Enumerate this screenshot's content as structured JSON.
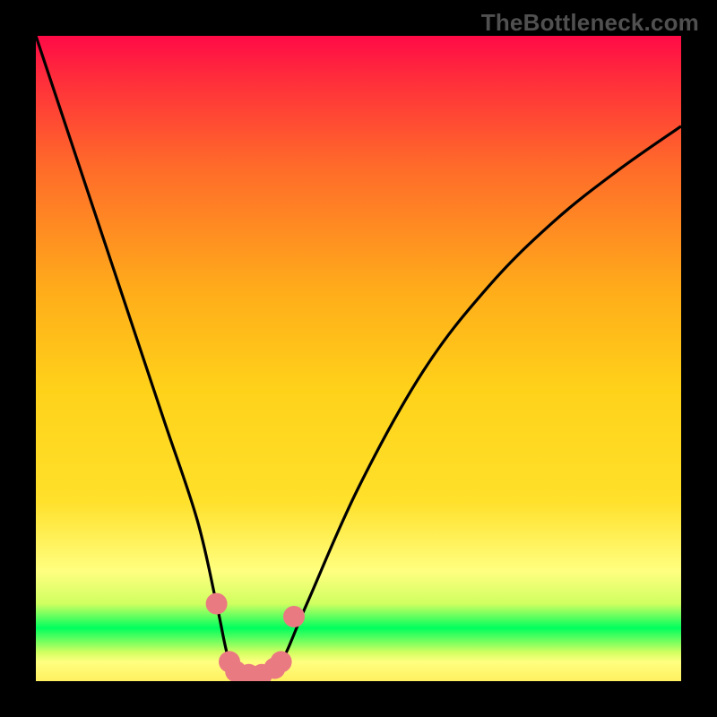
{
  "watermark": {
    "text": "TheBottleneck.com"
  },
  "chart_data": {
    "type": "line",
    "title": "",
    "xlabel": "",
    "ylabel": "",
    "xlim": [
      0,
      100
    ],
    "ylim": [
      0,
      100
    ],
    "curve": {
      "x": [
        0,
        5,
        10,
        15,
        20,
        25,
        28,
        30,
        32,
        35,
        38,
        42,
        50,
        60,
        70,
        80,
        90,
        100
      ],
      "y": [
        100,
        85,
        70,
        55,
        40,
        25,
        12,
        3,
        1,
        1,
        3,
        12,
        30,
        48,
        61,
        71,
        79,
        86
      ]
    },
    "markers": {
      "style": "pink_dots",
      "points": [
        {
          "x": 28,
          "y": 12
        },
        {
          "x": 30,
          "y": 3
        },
        {
          "x": 31,
          "y": 1.5
        },
        {
          "x": 33,
          "y": 1
        },
        {
          "x": 35,
          "y": 1
        },
        {
          "x": 37,
          "y": 2
        },
        {
          "x": 38,
          "y": 3
        },
        {
          "x": 40,
          "y": 10
        }
      ]
    },
    "background_gradient": {
      "top_color": "#ff0a47",
      "mid_color": "#ffe02a",
      "green_band_color": "#00ff5e",
      "band_top_fraction": 0.88,
      "band_bottom_fraction": 0.955
    }
  }
}
